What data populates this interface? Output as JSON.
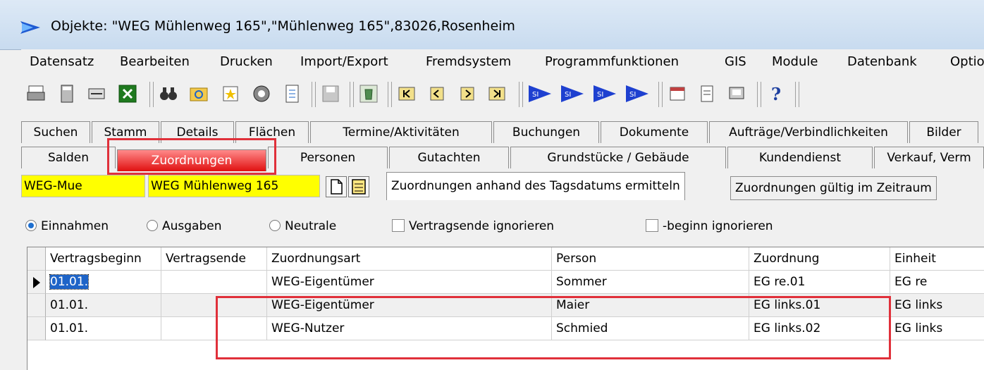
{
  "window": {
    "title": "Objekte: \"WEG Mühlenweg 165\",\"Mühlenweg 165\",83026,Rosenheim"
  },
  "menu": [
    "Datensatz",
    "Bearbeiten",
    "Drucken",
    "Import/Export",
    "Fremdsystem",
    "Programmfunktionen",
    "GIS",
    "Module",
    "Datenbank",
    "Optio"
  ],
  "toolbar_icons": [
    "print-icon",
    "calculator-icon",
    "scan-icon",
    "excel-icon",
    "binoculars-icon",
    "refresh-folder-icon",
    "star-icon",
    "globe-icon",
    "document-icon",
    "save-icon",
    "trash-icon",
    "first-record-icon",
    "previous-record-icon",
    "next-record-icon",
    "last-record-icon",
    "si-first-icon",
    "si-prev-icon",
    "si-next-icon",
    "si-last-icon",
    "calendar-icon",
    "note-icon",
    "device-icon",
    "help-icon"
  ],
  "tabs_row1": [
    "Suchen",
    "Stamm",
    "Details",
    "Flächen",
    "Termine/Aktivitäten",
    "Buchungen",
    "Dokumente",
    "Aufträge/Verbindlichkeiten",
    "Bilder"
  ],
  "tabs_row2": [
    "Salden",
    "Zuordnungen",
    "Personen",
    "Gutachten",
    "Grundstücke / Gebäude",
    "Kundendienst",
    "Verkauf, Verm"
  ],
  "active_tab": "Zuordnungen",
  "fields": {
    "code": "WEG-Mue",
    "name": "WEG Mühlenweg 165"
  },
  "subtabs": [
    "Zuordnungen anhand des Tagsdatums ermitteln",
    "Zuordnungen gültig im Zeitraum"
  ],
  "filters": {
    "radios": [
      {
        "label": "Einnahmen",
        "checked": true
      },
      {
        "label": "Ausgaben",
        "checked": false
      },
      {
        "label": "Neutrale",
        "checked": false
      }
    ],
    "checkboxes": [
      {
        "label": "Vertragsende ignorieren",
        "checked": false
      },
      {
        "label": "-beginn ignorieren",
        "checked": false
      }
    ]
  },
  "table": {
    "columns": [
      "Vertragsbeginn",
      "Vertragsende",
      "Zuordnungsart",
      "Person",
      "Zuordnung",
      "Einheit"
    ],
    "rows": [
      [
        "01.01.",
        "",
        "WEG-Eigentümer",
        "Sommer",
        "EG re.01",
        "EG re"
      ],
      [
        "01.01.",
        "",
        "WEG-Eigentümer",
        "Maier",
        "EG links.01",
        "EG links"
      ],
      [
        "01.01.",
        "",
        "WEG-Nutzer",
        "Schmied",
        "EG links.02",
        "EG links"
      ]
    ]
  },
  "colors": {
    "highlight": "#e0303a",
    "active_tab": "#e01010",
    "field_bg": "#ffff00",
    "selection": "#1e64c8"
  }
}
